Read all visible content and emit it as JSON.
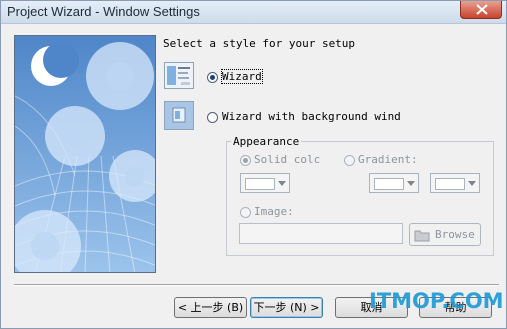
{
  "window": {
    "title": "Project Wizard - Window Settings"
  },
  "setup": {
    "prompt": "Select a style for your setup",
    "options": [
      {
        "label": "Wizard",
        "checked": true
      },
      {
        "label": "Wizard with background wind",
        "checked": false
      }
    ]
  },
  "appearance": {
    "title": "Appearance",
    "solid_color_label": "Solid colc",
    "gradient_label": "Gradient:",
    "image_label": "Image:",
    "image_value": "",
    "browse_label": "Browse"
  },
  "buttons": {
    "back": "< 上一步 (B)",
    "next": "下一步 (N) >",
    "cancel": "取消",
    "help": "帮助"
  },
  "watermark": "ITMOP.COM",
  "colors": {
    "accent": "#1d3f6e",
    "watermark": "#1f9bd8",
    "side_image_bg": "#5d8fc9"
  }
}
